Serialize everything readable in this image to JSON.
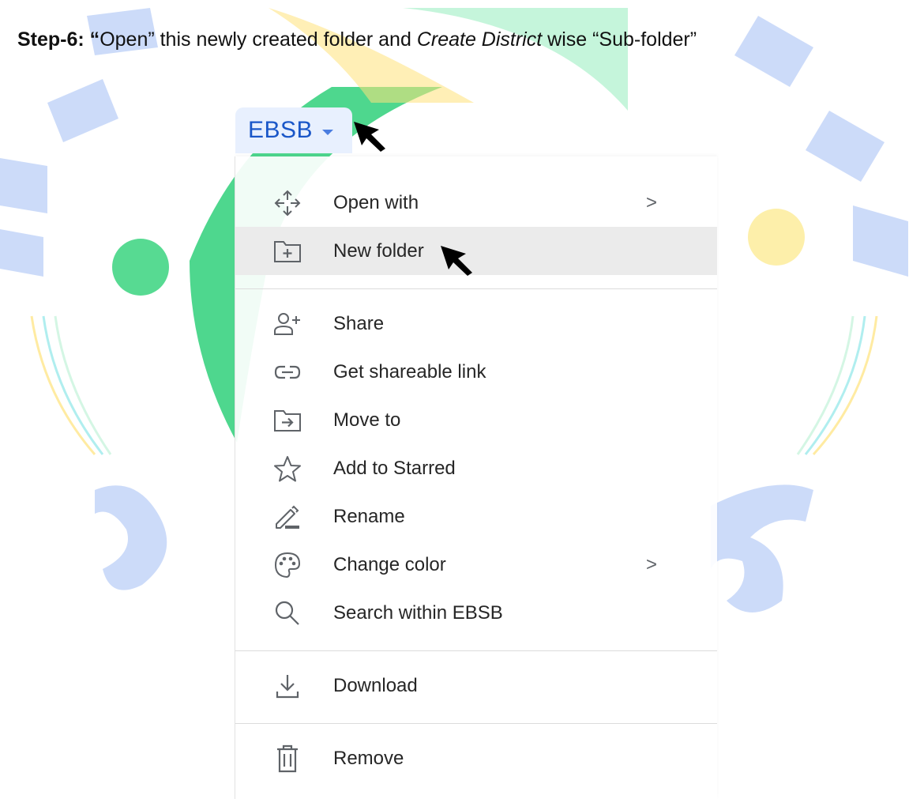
{
  "instruction": {
    "step": "Step-6: “",
    "part1": "Open” this newly created folder and ",
    "emphasis": "Create District",
    "part2": " wise “Sub-folder”"
  },
  "folder": {
    "name": "EBSB"
  },
  "menu": {
    "items": [
      {
        "label": "Open with",
        "icon": "open-with-icon",
        "has_submenu": true
      },
      {
        "label": "New folder",
        "icon": "new-folder-icon",
        "highlighted": true
      },
      {
        "label": "Share",
        "icon": "add-person-icon"
      },
      {
        "label": "Get shareable link",
        "icon": "link-icon"
      },
      {
        "label": "Move to",
        "icon": "move-to-icon"
      },
      {
        "label": "Add to Starred",
        "icon": "star-icon"
      },
      {
        "label": "Rename",
        "icon": "pencil-icon"
      },
      {
        "label": "Change color",
        "icon": "palette-icon",
        "has_submenu": true
      },
      {
        "label": "Search within EBSB",
        "icon": "search-icon"
      },
      {
        "label": "Download",
        "icon": "download-icon"
      },
      {
        "label": "Remove",
        "icon": "trash-icon"
      }
    ],
    "submenu_glyph": ">"
  },
  "colors": {
    "folder_chip_bg": "#e8f0fe",
    "folder_name": "#1a57c8",
    "highlight_bg": "#ebebeb"
  }
}
